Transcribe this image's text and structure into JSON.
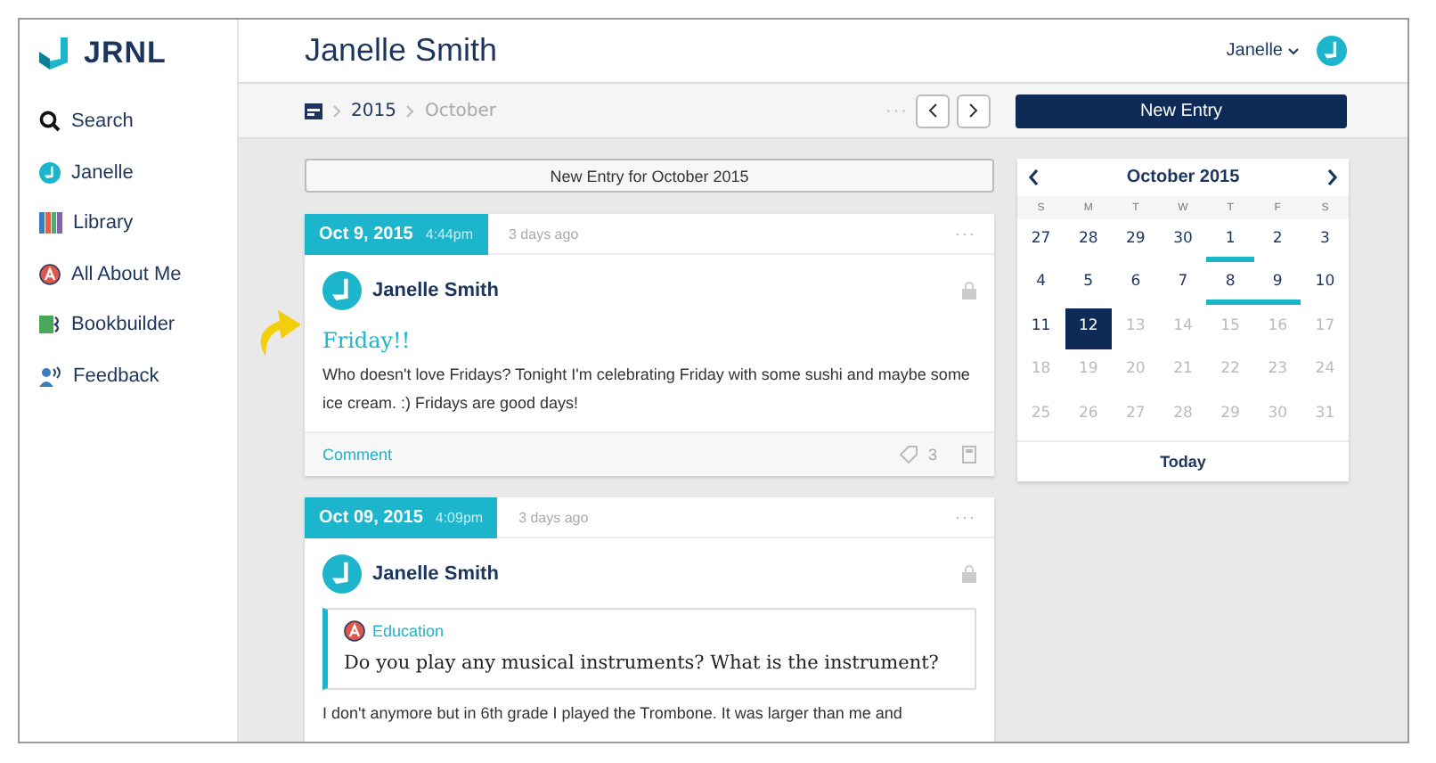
{
  "logo": {
    "text": "JRNL"
  },
  "sidebar": {
    "items": [
      {
        "label": "Search",
        "kind": "search"
      },
      {
        "label": "Janelle",
        "kind": "avatar"
      },
      {
        "label": "Library",
        "kind": "library"
      },
      {
        "label": "All About Me",
        "kind": "about"
      },
      {
        "label": "Bookbuilder",
        "kind": "book"
      },
      {
        "label": "Feedback",
        "kind": "feedback"
      }
    ]
  },
  "header": {
    "title": "Janelle Smith",
    "user": "Janelle"
  },
  "breadcrumb": {
    "year": "2015",
    "month": "October",
    "more": "···"
  },
  "new_entry_button": "New Entry",
  "new_entry_for": "New Entry for October 2015",
  "entries": [
    {
      "date": "Oct 9, 2015",
      "time": "4:44pm",
      "ago": "3 days ago",
      "more": "···",
      "author": "Janelle Smith",
      "title": "Friday!!",
      "body": "Who doesn't love Fridays? Tonight I'm celebrating Friday with some sushi and maybe some ice cream. :) Fridays are good days!",
      "comment": "Comment",
      "tags": "3"
    },
    {
      "date": "Oct 09, 2015",
      "time": "4:09pm",
      "ago": "3 days ago",
      "more": "···",
      "author": "Janelle Smith",
      "prompt_category": "Education",
      "prompt": "Do you play any musical instruments? What is the instrument?",
      "body": "I don't anymore but in 6th grade I played the Trombone. It was larger than me and"
    }
  ],
  "calendar": {
    "title": "October 2015",
    "weekdays": [
      "S",
      "M",
      "T",
      "W",
      "T",
      "F",
      "S"
    ],
    "today": "Today",
    "weeks": [
      [
        {
          "d": "27",
          "muted": false,
          "entry": false,
          "selected": false
        },
        {
          "d": "28",
          "muted": false,
          "entry": false,
          "selected": false
        },
        {
          "d": "29",
          "muted": false,
          "entry": false,
          "selected": false
        },
        {
          "d": "30",
          "muted": false,
          "entry": false,
          "selected": false
        },
        {
          "d": "1",
          "muted": false,
          "entry": true,
          "selected": false
        },
        {
          "d": "2",
          "muted": false,
          "entry": false,
          "selected": false
        },
        {
          "d": "3",
          "muted": false,
          "entry": false,
          "selected": false
        }
      ],
      [
        {
          "d": "4",
          "muted": false,
          "entry": false,
          "selected": false
        },
        {
          "d": "5",
          "muted": false,
          "entry": false,
          "selected": false
        },
        {
          "d": "6",
          "muted": false,
          "entry": false,
          "selected": false
        },
        {
          "d": "7",
          "muted": false,
          "entry": false,
          "selected": false
        },
        {
          "d": "8",
          "muted": false,
          "entry": true,
          "selected": false
        },
        {
          "d": "9",
          "muted": false,
          "entry": true,
          "selected": false
        },
        {
          "d": "10",
          "muted": false,
          "entry": false,
          "selected": false
        }
      ],
      [
        {
          "d": "11",
          "muted": false,
          "entry": false,
          "selected": false
        },
        {
          "d": "12",
          "muted": false,
          "entry": false,
          "selected": true
        },
        {
          "d": "13",
          "muted": true,
          "entry": false,
          "selected": false
        },
        {
          "d": "14",
          "muted": true,
          "entry": false,
          "selected": false
        },
        {
          "d": "15",
          "muted": true,
          "entry": false,
          "selected": false
        },
        {
          "d": "16",
          "muted": true,
          "entry": false,
          "selected": false
        },
        {
          "d": "17",
          "muted": true,
          "entry": false,
          "selected": false
        }
      ],
      [
        {
          "d": "18",
          "muted": true,
          "entry": false,
          "selected": false
        },
        {
          "d": "19",
          "muted": true,
          "entry": false,
          "selected": false
        },
        {
          "d": "20",
          "muted": true,
          "entry": false,
          "selected": false
        },
        {
          "d": "21",
          "muted": true,
          "entry": false,
          "selected": false
        },
        {
          "d": "22",
          "muted": true,
          "entry": false,
          "selected": false
        },
        {
          "d": "23",
          "muted": true,
          "entry": false,
          "selected": false
        },
        {
          "d": "24",
          "muted": true,
          "entry": false,
          "selected": false
        }
      ],
      [
        {
          "d": "25",
          "muted": true,
          "entry": false,
          "selected": false
        },
        {
          "d": "26",
          "muted": true,
          "entry": false,
          "selected": false
        },
        {
          "d": "27",
          "muted": true,
          "entry": false,
          "selected": false
        },
        {
          "d": "28",
          "muted": true,
          "entry": false,
          "selected": false
        },
        {
          "d": "29",
          "muted": true,
          "entry": false,
          "selected": false
        },
        {
          "d": "30",
          "muted": true,
          "entry": false,
          "selected": false
        },
        {
          "d": "31",
          "muted": true,
          "entry": false,
          "selected": false
        }
      ]
    ]
  }
}
